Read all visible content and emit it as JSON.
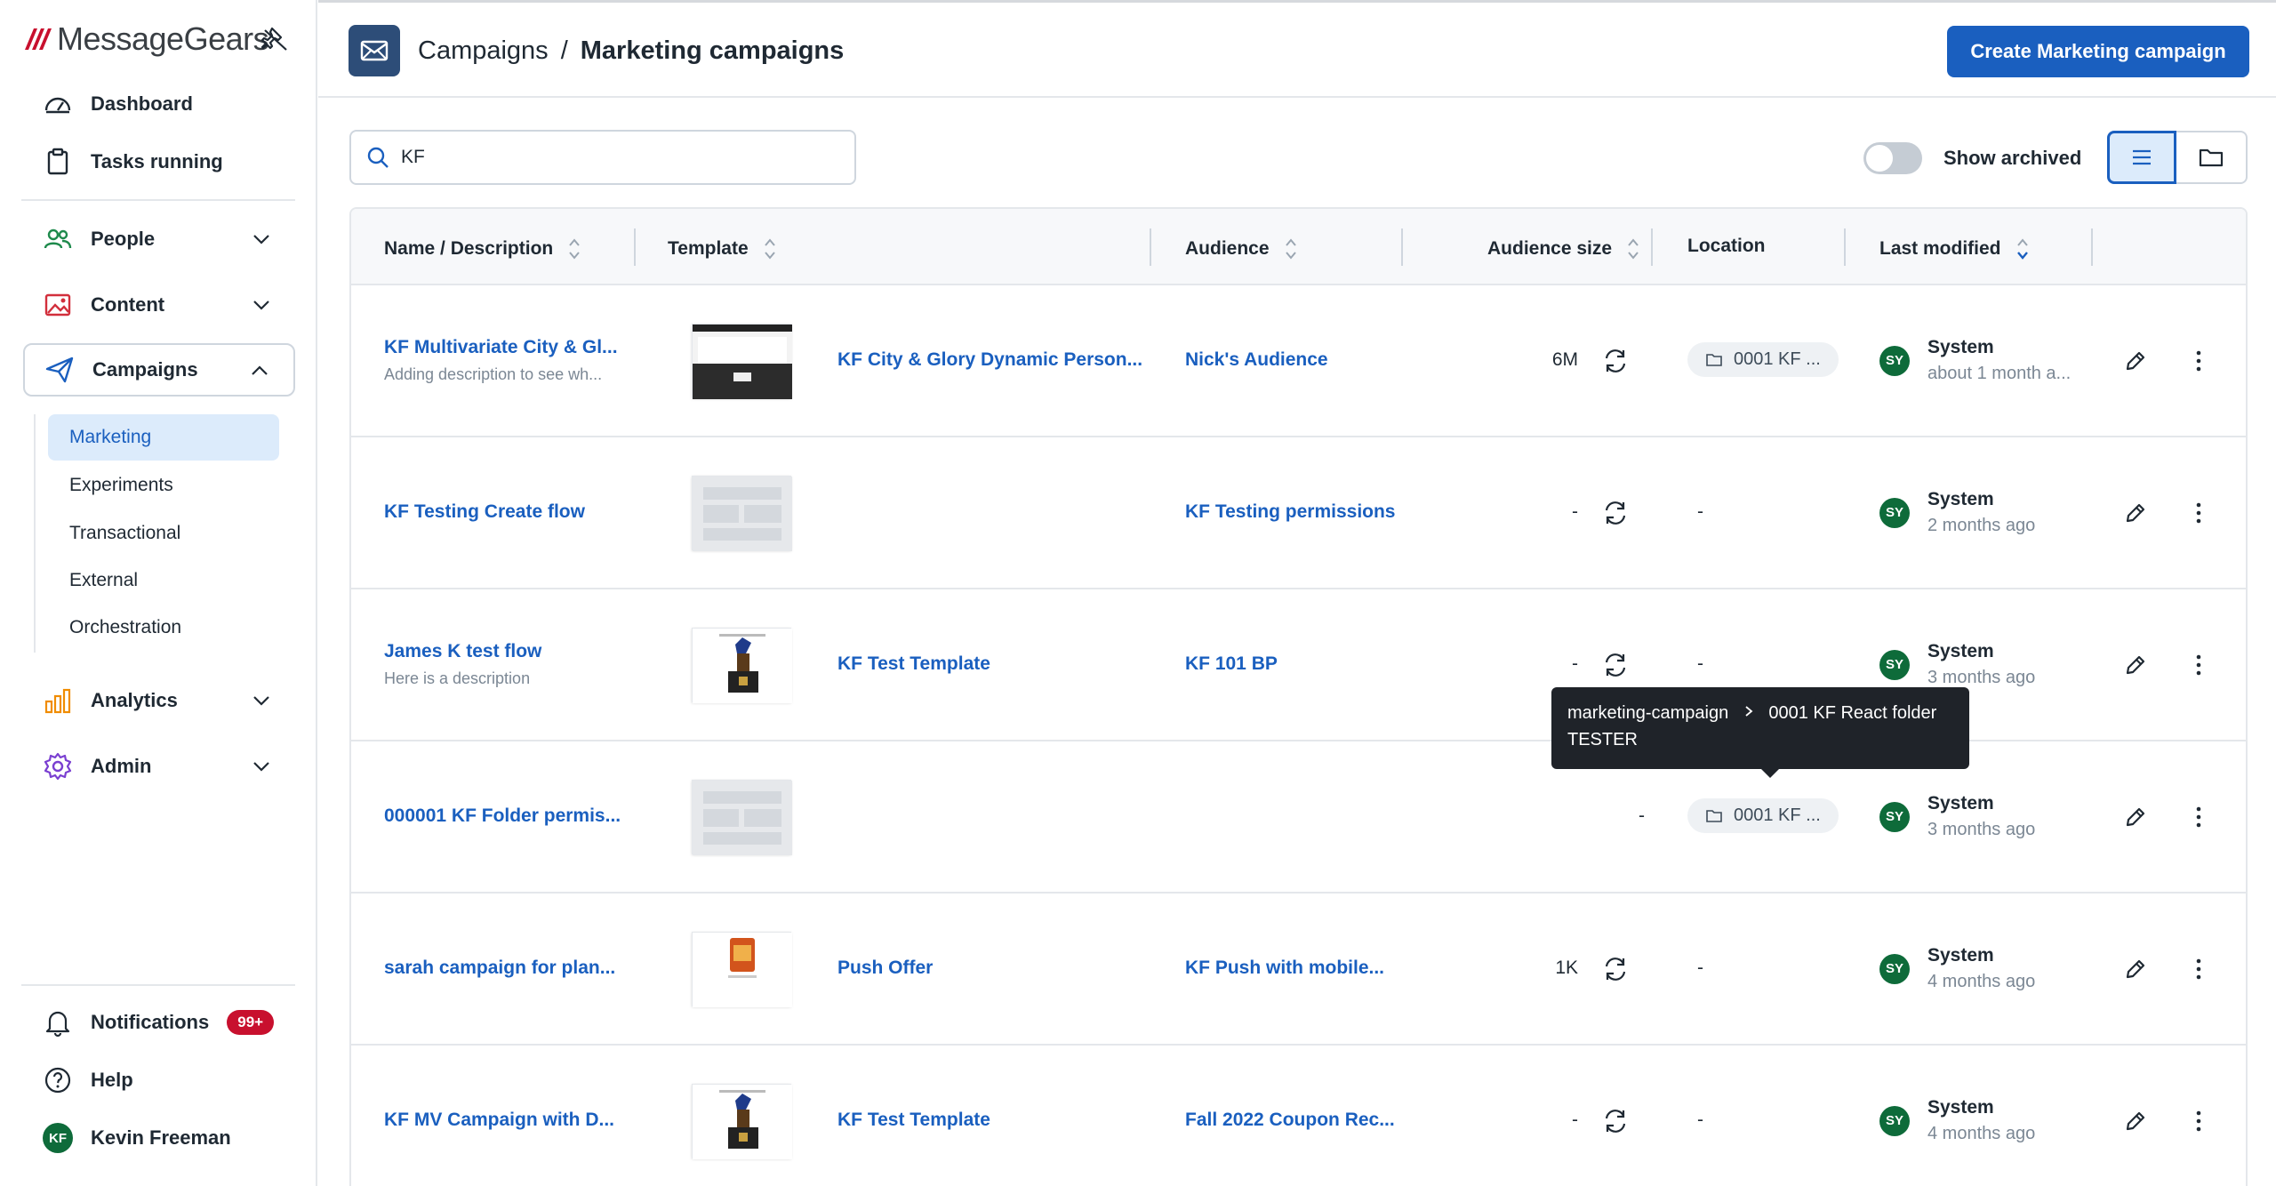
{
  "brand": {
    "name": "MessageGears"
  },
  "sidebar": {
    "top_items": [
      {
        "label": "Dashboard"
      },
      {
        "label": "Tasks running"
      }
    ],
    "groups": [
      {
        "label": "People"
      },
      {
        "label": "Content"
      },
      {
        "label": "Campaigns"
      },
      {
        "label": "Analytics"
      },
      {
        "label": "Admin"
      }
    ],
    "campaign_subitems": [
      {
        "label": "Marketing",
        "active": true
      },
      {
        "label": "Experiments"
      },
      {
        "label": "Transactional"
      },
      {
        "label": "External"
      },
      {
        "label": "Orchestration"
      }
    ],
    "bottom": {
      "notifications_label": "Notifications",
      "notifications_badge": "99+",
      "help_label": "Help",
      "user_initials": "KF",
      "user_name": "Kevin Freeman"
    }
  },
  "header": {
    "breadcrumb_parent": "Campaigns",
    "breadcrumb_sep": "/",
    "breadcrumb_current": "Marketing campaigns",
    "create_button": "Create Marketing campaign"
  },
  "toolbar": {
    "search_value": "KF",
    "show_archived_label": "Show archived"
  },
  "table": {
    "columns": {
      "name": "Name / Description",
      "template": "Template",
      "audience": "Audience",
      "audience_size": "Audience size",
      "location": "Location",
      "last_modified": "Last modified"
    },
    "rows": [
      {
        "name": "KF Multivariate City & Gl...",
        "description": "Adding description to see wh...",
        "template": "KF City & Glory Dynamic Person...",
        "audience": "Nick's Audience",
        "size": "6M",
        "location": "0001 KF ...",
        "modified_initials": "SY",
        "modified_by": "System",
        "modified_time": "about 1 month a..."
      },
      {
        "name": "KF Testing Create flow",
        "description": "",
        "template": "",
        "audience": "KF Testing permissions",
        "size": "-",
        "location": "-",
        "modified_initials": "SY",
        "modified_by": "System",
        "modified_time": "2 months ago"
      },
      {
        "name": "James K test flow",
        "description": "Here is a description",
        "template": "KF Test Template",
        "audience": "KF 101 BP",
        "size": "-",
        "location": "-",
        "modified_initials": "SY",
        "modified_by": "System",
        "modified_time": "3 months ago"
      },
      {
        "name": "000001 KF Folder permis...",
        "description": "",
        "template": "",
        "audience": "",
        "size": "-",
        "location": "0001 KF ...",
        "modified_initials": "SY",
        "modified_by": "System",
        "modified_time": "3 months ago"
      },
      {
        "name": "sarah campaign for plan...",
        "description": "",
        "template": "Push Offer",
        "audience": "KF Push with mobile...",
        "size": "1K",
        "location": "-",
        "modified_initials": "SY",
        "modified_by": "System",
        "modified_time": "4 months ago"
      },
      {
        "name": "KF MV Campaign with D...",
        "description": "",
        "template": "KF Test Template",
        "audience": "Fall 2022 Coupon Rec...",
        "size": "-",
        "location": "-",
        "modified_initials": "SY",
        "modified_by": "System",
        "modified_time": "4 months ago"
      }
    ]
  },
  "tooltip": {
    "path_root": "marketing-campaign",
    "path_folder": "0001 KF React folder TESTER"
  },
  "colors": {
    "brand_blue": "#1a5fbf",
    "header_icon_bg": "#2d4d78",
    "badge_red": "#c8102e",
    "avatar_green": "#0e6b3a"
  }
}
